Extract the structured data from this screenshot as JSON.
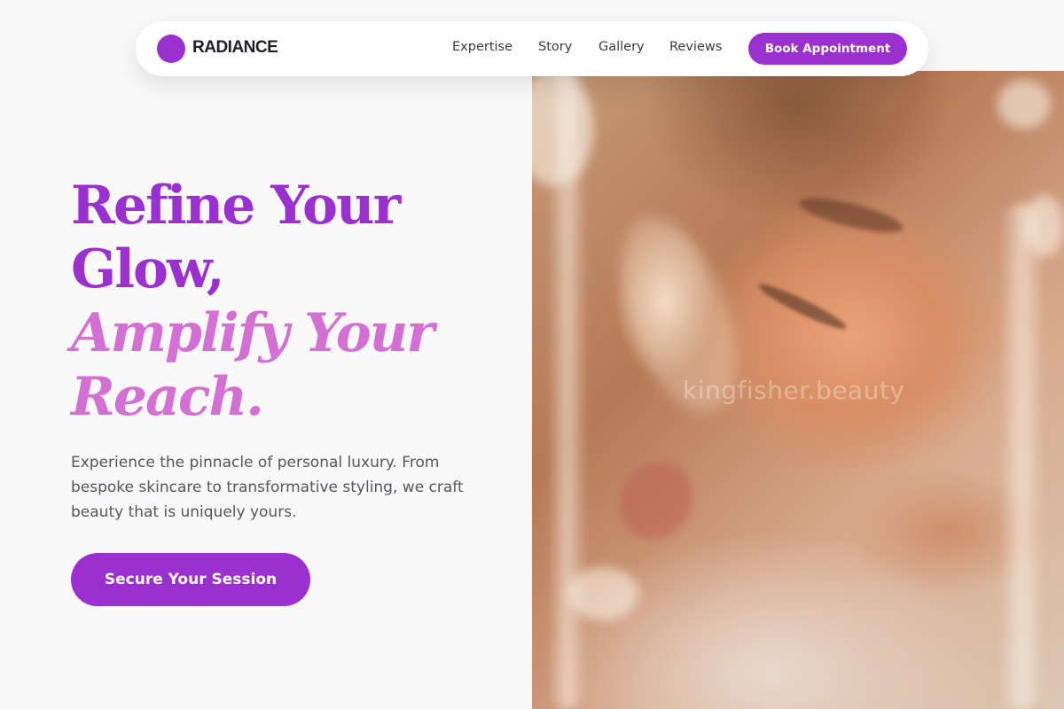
{
  "brand": {
    "name": "RADIANCE",
    "color": "#9b30d0"
  },
  "nav": {
    "links": [
      "Expertise",
      "Story",
      "Gallery",
      "Reviews"
    ],
    "cta_label": "Book Appointment"
  },
  "hero": {
    "headline_line1": "Refine Your",
    "headline_line2": "Glow,",
    "headline_accent_line1": "Amplify Your",
    "headline_accent_line2": "Reach.",
    "description": "Experience the pinnacle of personal luxury. From bespoke skincare to transformative styling, we craft beauty that is uniquely yours.",
    "cta_label": "Secure Your Session",
    "accent_color": "#d46fd4",
    "image_watermark": "kingfisher.beauty"
  }
}
